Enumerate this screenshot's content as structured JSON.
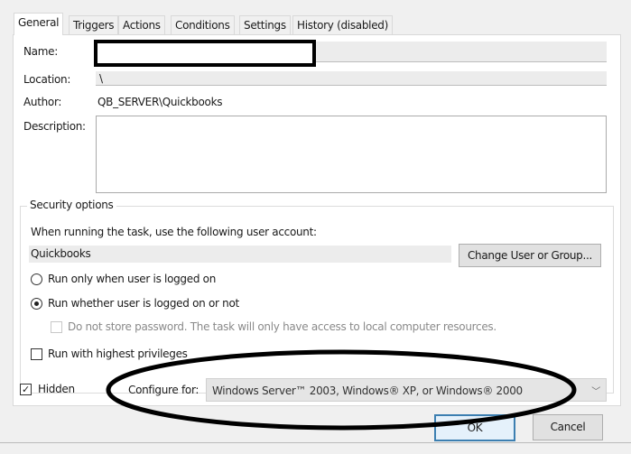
{
  "tabs": [
    "General",
    "Triggers",
    "Actions",
    "Conditions",
    "Settings",
    "History (disabled)"
  ],
  "general": {
    "name_label": "Name:",
    "name_value": "",
    "location_label": "Location:",
    "location_value": "\\",
    "author_label": "Author:",
    "author_value": "QB_SERVER\\Quickbooks",
    "description_label": "Description:",
    "description_value": ""
  },
  "security": {
    "legend": "Security options",
    "account_prompt": "When running the task, use the following user account:",
    "account_value": "Quickbooks",
    "change_button": "Change User or Group...",
    "radio_logged_on": "Run only when user is logged on",
    "radio_whether": "Run whether user is logged on or not",
    "selected_radio": "Run whether user is logged on or not",
    "no_store_password": "Do not store password.  The task will only have access to local computer resources.",
    "no_store_password_checked": false,
    "highest_privileges": "Run with highest privileges",
    "highest_privileges_checked": false
  },
  "hidden": {
    "label": "Hidden",
    "checked": true
  },
  "configure": {
    "label": "Configure for:",
    "value": "Windows Server™ 2003, Windows® XP, or Windows® 2000"
  },
  "buttons": {
    "ok": "OK",
    "cancel": "Cancel"
  },
  "annotations": {
    "redaction_color": "#000000",
    "ellipse_color": "#000000"
  }
}
